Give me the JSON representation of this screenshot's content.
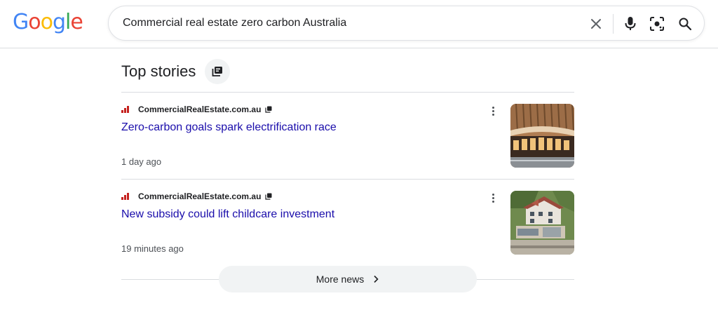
{
  "logo": {
    "letters": [
      "G",
      "o",
      "o",
      "g",
      "l",
      "e"
    ],
    "colors": [
      "#4285F4",
      "#EA4335",
      "#FBBC05",
      "#4285F4",
      "#34A853",
      "#EA4335"
    ]
  },
  "search": {
    "query": "Commercial real estate zero carbon Australia",
    "icons": [
      "close-icon",
      "microphone-icon",
      "lens-icon",
      "search-icon"
    ]
  },
  "top_stories": {
    "title": "Top stories",
    "stories": [
      {
        "source": "CommercialRealEstate.com.au",
        "headline": "Zero-carbon goals spark electrification race",
        "time": "1 day ago",
        "thumbnail": "building-photo"
      },
      {
        "source": "CommercialRealEstate.com.au",
        "headline": "New subsidy could lift childcare investment",
        "time": "19 minutes ago",
        "thumbnail": "house-aerial-photo"
      }
    ],
    "more_news_label": "More news"
  },
  "colors": {
    "link": "#1a0dab",
    "text": "#202124",
    "meta": "#4d5156",
    "divider": "#dadce0",
    "favicon": "#c5221f"
  }
}
